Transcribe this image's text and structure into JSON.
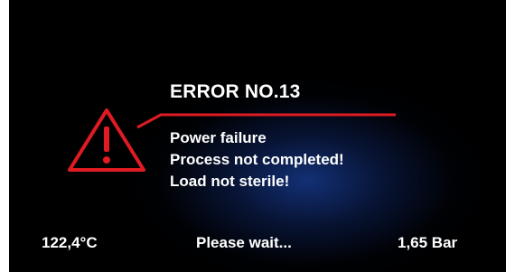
{
  "error": {
    "title": "ERROR NO.13",
    "messages": [
      "Power failure",
      "Process not completed!",
      "Load not sterile!"
    ],
    "icon": "warning-triangle-icon",
    "accent_color": "#e01b22"
  },
  "status_bar": {
    "temperature": "122,4°C",
    "message": "Please wait...",
    "pressure": "1,65 Bar"
  },
  "colors": {
    "background": "#000000",
    "glow": "#183e96",
    "text": "#ffffff"
  }
}
